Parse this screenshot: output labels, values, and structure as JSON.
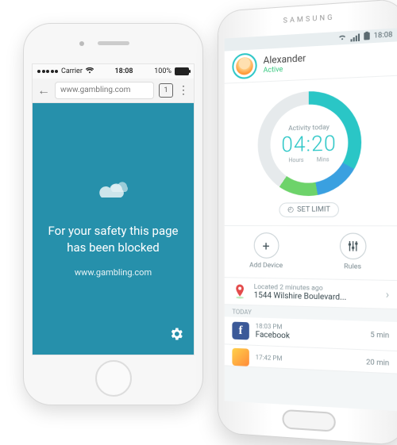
{
  "iphone": {
    "status": {
      "carrier": "Carrier",
      "time": "18:08",
      "battery_pct": "100%"
    },
    "browser": {
      "url": "www.gambling.com",
      "tab_count": "1"
    },
    "blocked": {
      "message": "For your safety this page has been blocked",
      "site": "www.gambling.com"
    }
  },
  "samsung": {
    "brand": "SAMSUNG",
    "status": {
      "time": "18:08"
    },
    "profile": {
      "name": "Alexander",
      "status": "Active"
    },
    "ring": {
      "label": "Activity today",
      "hours": "04",
      "mins": "20",
      "hours_label": "Hours",
      "mins_label": "Mins",
      "set_limit_label": "SET LIMIT"
    },
    "actions": {
      "add_device": "Add Device",
      "rules": "Rules"
    },
    "location": {
      "ago": "Located 2 minutes ago",
      "address": "1544 Wilshire Boulevard..."
    },
    "section_today": "TODAY",
    "apps": [
      {
        "time": "18:03 PM",
        "name": "Facebook",
        "duration": "5 min"
      },
      {
        "time": "17:42 PM",
        "name": "",
        "duration": "20 min"
      }
    ]
  }
}
